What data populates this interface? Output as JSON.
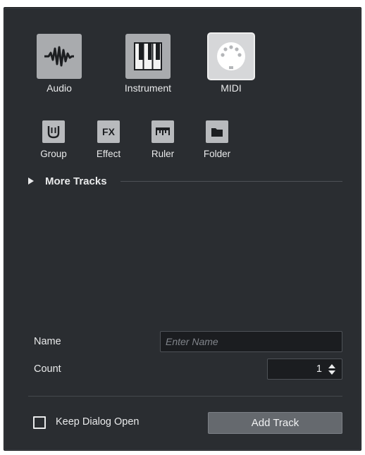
{
  "track_types": [
    {
      "label": "Audio",
      "icon": "waveform-icon",
      "selected": false
    },
    {
      "label": "Instrument",
      "icon": "piano-keys-icon",
      "selected": false
    },
    {
      "label": "MIDI",
      "icon": "midi-connector-icon",
      "selected": true
    }
  ],
  "secondary_types": [
    {
      "label": "Group",
      "icon": "group-icon"
    },
    {
      "label": "Effect",
      "icon": "fx-icon",
      "glyph": "FX"
    },
    {
      "label": "Ruler",
      "icon": "ruler-icon"
    },
    {
      "label": "Folder",
      "icon": "folder-icon"
    }
  ],
  "more_tracks_label": "More Tracks",
  "name": {
    "label": "Name",
    "value": "",
    "placeholder": "Enter Name"
  },
  "count": {
    "label": "Count",
    "value": "1"
  },
  "keep_open": {
    "label": "Keep Dialog Open",
    "checked": false
  },
  "add_track_label": "Add Track",
  "colors": {
    "background": "#2a2d31",
    "tile": "#a9abae",
    "selected_tile": "#d6d7d9",
    "button": "#65696e"
  }
}
